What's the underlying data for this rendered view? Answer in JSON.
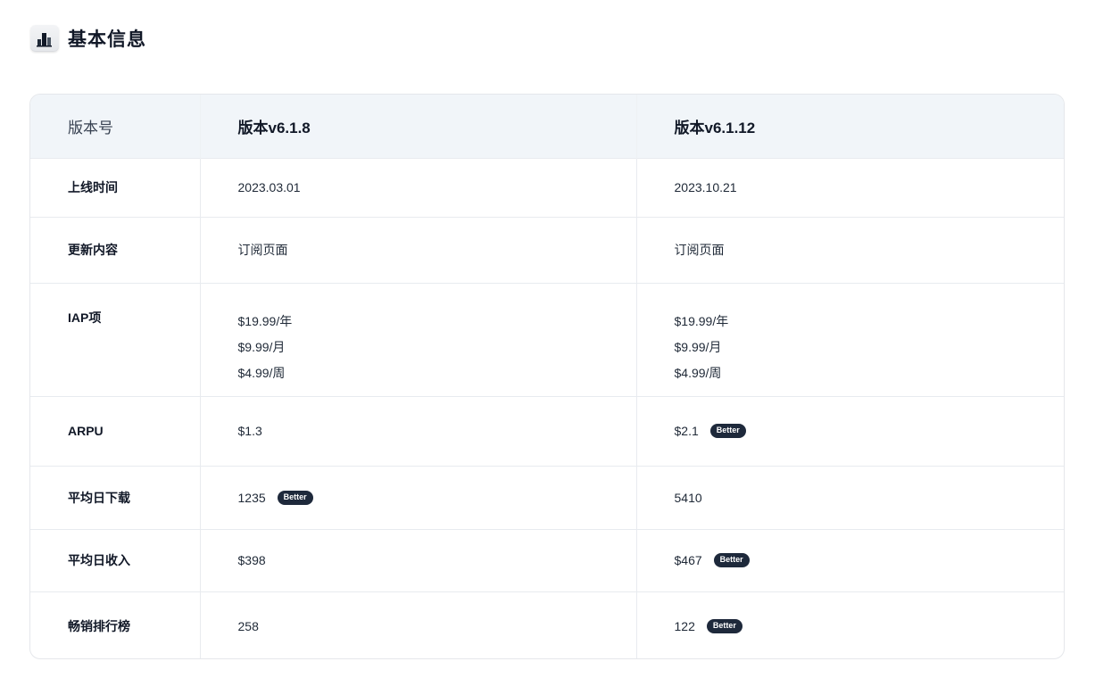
{
  "section": {
    "title": "基本信息",
    "icon": "bar-chart-icon"
  },
  "table": {
    "headers": [
      "版本号",
      "版本v6.1.8",
      "版本v6.1.12"
    ],
    "rows": {
      "launch": {
        "label": "上线时间",
        "v1": "2023.03.01",
        "v2": "2023.10.21"
      },
      "update": {
        "label": "更新内容",
        "v1": "订阅页面",
        "v2": "订阅页面"
      },
      "iap": {
        "label": "IAP项",
        "v1": [
          "$19.99/年",
          "$9.99/月",
          "$4.99/周"
        ],
        "v2": [
          "$19.99/年",
          "$9.99/月",
          "$4.99/周"
        ]
      },
      "arpu": {
        "label": "ARPU",
        "v1": "$1.3",
        "v2": "$2.1",
        "v2_badge": "Better"
      },
      "downloads": {
        "label": "平均日下载",
        "v1": "1235",
        "v1_badge": "Better",
        "v2": "5410"
      },
      "revenue": {
        "label": "平均日收入",
        "v1": "$398",
        "v2": "$467",
        "v2_badge": "Better"
      },
      "ranking": {
        "label": "畅销排行榜",
        "v1": "258",
        "v2": "122",
        "v2_badge": "Better"
      }
    }
  },
  "colors": {
    "header_bg": "#f1f5f9",
    "badge_bg": "#1e293b",
    "border": "#e5e7eb"
  }
}
